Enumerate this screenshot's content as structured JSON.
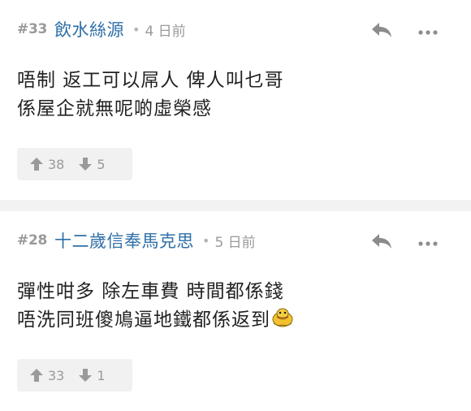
{
  "posts": [
    {
      "floor": "#33",
      "username": "飲水絲源",
      "separator": "•",
      "time": "4 日前",
      "lines": [
        "唔制 返工可以屌人 俾人叫乜哥",
        "係屋企就無呢啲虛榮感"
      ],
      "upvotes": "38",
      "downvotes": "5"
    },
    {
      "floor": "#28",
      "username": "十二歲信奉馬克思",
      "separator": "•",
      "time": "5 日前",
      "lines": [
        "彈性咁多 除左車費 時間都係錢",
        "唔洗同班傻鳩逼地鐵都係返到"
      ],
      "upvotes": "33",
      "downvotes": "1"
    }
  ],
  "icons": {
    "reply": "reply-arrow-icon",
    "more": "more-dots-icon",
    "upvote": "arrow-up-icon",
    "downvote": "arrow-down-icon",
    "emoji": "duck-emoji-icon"
  },
  "colors": {
    "username": "#2f6fa7",
    "meta_gray": "#9a9a9a",
    "icon_gray": "#8c8c8c",
    "vote_bg": "#f1f1f1",
    "separator": "#f2f2f2"
  }
}
